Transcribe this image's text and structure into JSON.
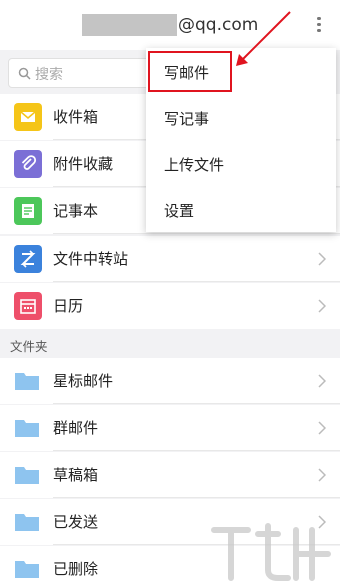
{
  "header": {
    "email_suffix": "@qq.com",
    "more_icon": "more-vertical-icon"
  },
  "search": {
    "placeholder": "搜索"
  },
  "mailboxes": [
    {
      "label": "收件箱",
      "icon": "inbox-icon",
      "color": "#f5c518"
    },
    {
      "label": "附件收藏",
      "icon": "attachment-icon",
      "color": "#7b6fd6"
    },
    {
      "label": "记事本",
      "icon": "notepad-icon",
      "color": "#4cc75a"
    },
    {
      "label": "文件中转站",
      "icon": "transfer-icon",
      "color": "#3b82dc"
    },
    {
      "label": "日历",
      "icon": "calendar-icon",
      "color": "#ee4f6a"
    }
  ],
  "folders_section": {
    "title": "文件夹"
  },
  "folders": [
    {
      "label": "星标邮件"
    },
    {
      "label": "群邮件"
    },
    {
      "label": "草稿箱"
    },
    {
      "label": "已发送"
    },
    {
      "label": "已删除"
    }
  ],
  "dropdown": {
    "items": [
      {
        "label": "写邮件"
      },
      {
        "label": "写记事"
      },
      {
        "label": "上传文件"
      },
      {
        "label": "设置"
      }
    ]
  },
  "colors": {
    "highlight": "#e0141f",
    "folder": "#8ec4ef"
  }
}
